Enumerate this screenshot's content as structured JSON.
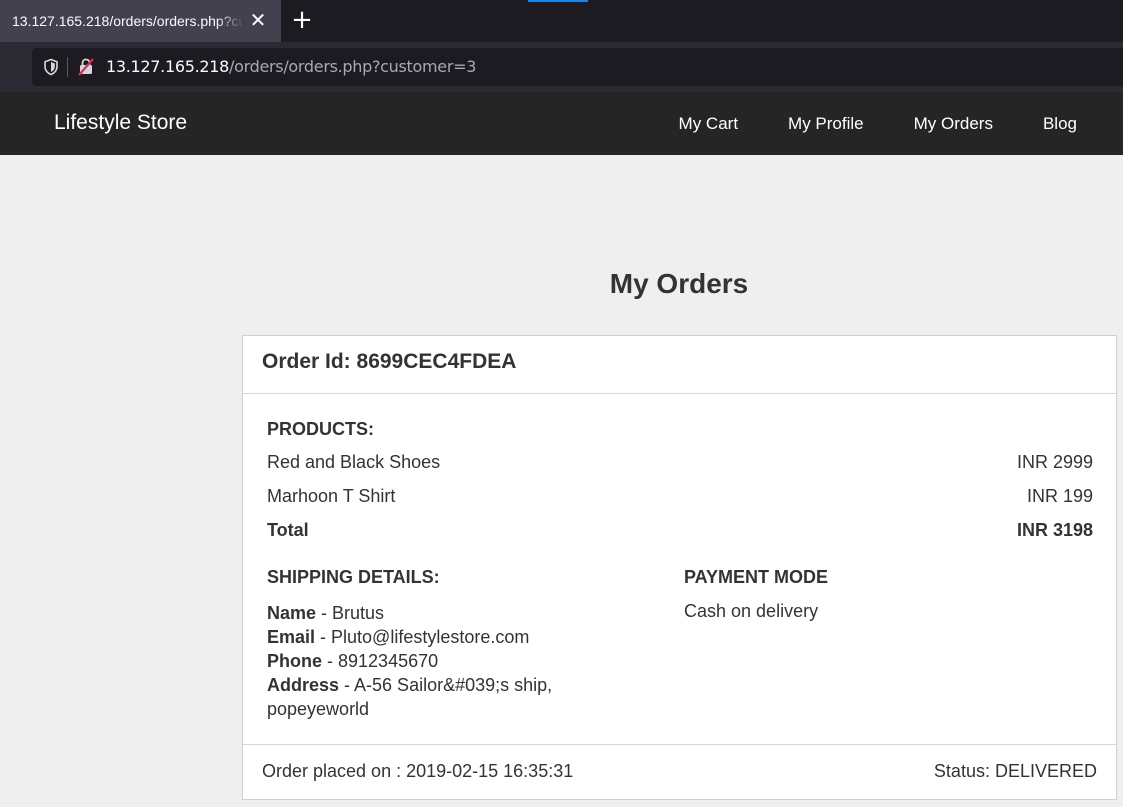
{
  "browser": {
    "tab_title": "13.127.165.218/orders/orders.php?customer=3",
    "url_host": "13.127.165.218",
    "url_path": "/orders/orders.php?customer=3"
  },
  "site": {
    "brand": "Lifestyle Store",
    "nav": [
      "My Cart",
      "My Profile",
      "My Orders",
      "Blog"
    ]
  },
  "page": {
    "title": "My Orders"
  },
  "order": {
    "id_label": "Order Id: 8699CEC4FDEA",
    "products_heading": "PRODUCTS:",
    "products": [
      {
        "name": "Red and Black Shoes",
        "price": "INR 2999"
      },
      {
        "name": "Marhoon T Shirt",
        "price": "INR 199"
      }
    ],
    "total_label": "Total",
    "total_value": "INR 3198",
    "shipping_heading": "SHIPPING DETAILS:",
    "shipping": {
      "name_label": "Name",
      "name_value": " - Brutus",
      "email_label": "Email",
      "email_value": " - Pluto@lifestylestore.com",
      "phone_label": "Phone",
      "phone_value": " - 8912345670",
      "address_label": "Address",
      "address_value": " - A-56 Sailor&#039;s ship, popeyeworld"
    },
    "payment_heading": "PAYMENT MODE",
    "payment_value": "Cash on delivery",
    "placed_on": "Order placed on : 2019-02-15 16:35:31",
    "status": "Status: DELIVERED"
  }
}
